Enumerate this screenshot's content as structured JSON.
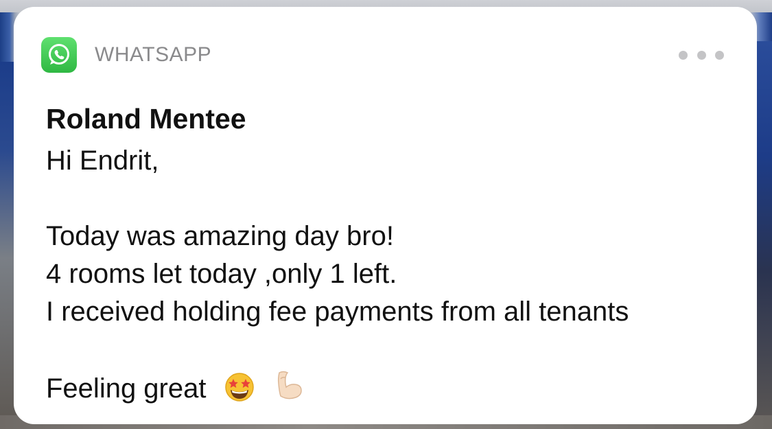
{
  "notification": {
    "app_name": "WHATSAPP",
    "app_icon": "whatsapp-logo-icon",
    "more_icon": "more-options-icon",
    "accent_color": "#34c24a",
    "sender": "Roland Mentee",
    "greeting": "Hi Endrit,",
    "lines": [
      "Today was amazing day bro!",
      "4 rooms let today ,only 1 left.",
      "I received holding fee payments from all tenants"
    ],
    "closing": "Feeling great",
    "emojis": [
      "star-struck-emoji",
      "flexed-biceps-emoji"
    ]
  }
}
